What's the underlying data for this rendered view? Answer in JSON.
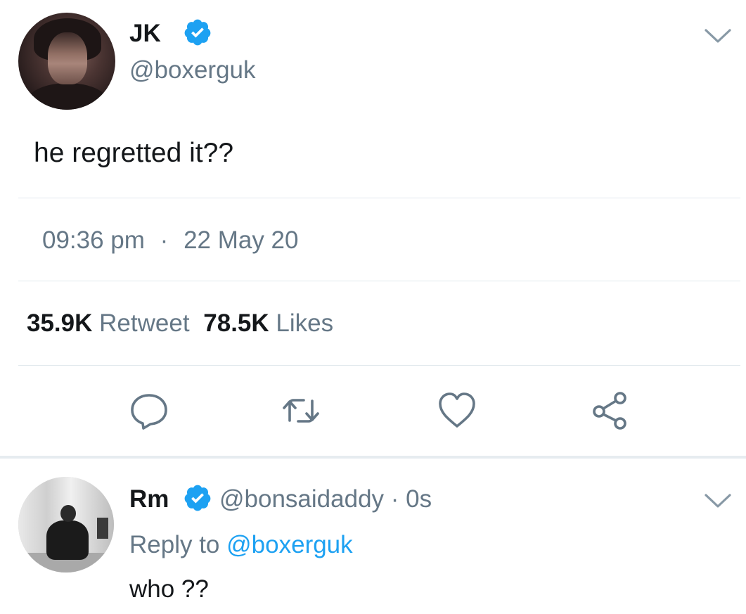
{
  "colors": {
    "text_primary": "#14171a",
    "text_secondary": "#657786",
    "accent_blue": "#1da1f2",
    "divider": "#e1e8ed",
    "icon_gray": "#657786"
  },
  "main_tweet": {
    "author_name": "JK",
    "author_handle": "@boxerguk",
    "verified": true,
    "text": "he regretted it??",
    "time": "09:36 pm",
    "separator": "·",
    "date": "22 May 20",
    "retweet_count": "35.9K",
    "retweet_label": "Retweet",
    "like_count": "78.5K",
    "like_label": "Likes",
    "actions": [
      {
        "icon": "reply-icon"
      },
      {
        "icon": "retweet-icon"
      },
      {
        "icon": "heart-icon"
      },
      {
        "icon": "share-icon"
      }
    ],
    "menu_icon": "chevron-down-icon"
  },
  "reply_tweet": {
    "author_name": "Rm",
    "verified": true,
    "author_handle_time": "@bonsaidaddy · 0s",
    "reply_to_label": "Reply to",
    "reply_to_handle": "@boxerguk",
    "text": "who ??",
    "menu_icon": "chevron-down-icon"
  }
}
